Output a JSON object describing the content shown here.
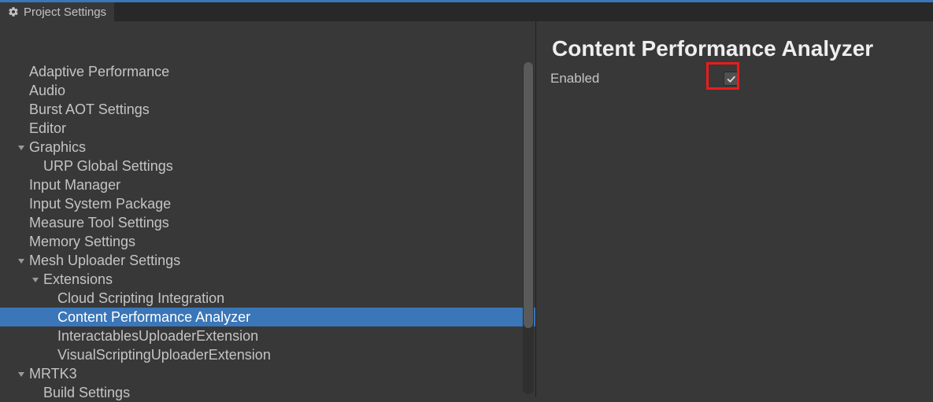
{
  "tab": {
    "title": "Project Settings",
    "icon": "gear-icon"
  },
  "tree": {
    "items": [
      {
        "label": "Adaptive Performance",
        "depth": 0,
        "arrow": "",
        "selected": false,
        "indent": 26
      },
      {
        "label": "Audio",
        "depth": 0,
        "arrow": "",
        "selected": false,
        "indent": 26
      },
      {
        "label": "Burst AOT Settings",
        "depth": 0,
        "arrow": "",
        "selected": false,
        "indent": 26
      },
      {
        "label": "Editor",
        "depth": 0,
        "arrow": "",
        "selected": false,
        "indent": 26
      },
      {
        "label": "Graphics",
        "depth": 0,
        "arrow": "down",
        "selected": false,
        "indent": 11
      },
      {
        "label": "URP Global Settings",
        "depth": 1,
        "arrow": "",
        "selected": false,
        "indent": 44
      },
      {
        "label": "Input Manager",
        "depth": 0,
        "arrow": "",
        "selected": false,
        "indent": 26
      },
      {
        "label": "Input System Package",
        "depth": 0,
        "arrow": "",
        "selected": false,
        "indent": 26
      },
      {
        "label": "Measure Tool Settings",
        "depth": 0,
        "arrow": "",
        "selected": false,
        "indent": 26
      },
      {
        "label": "Memory Settings",
        "depth": 0,
        "arrow": "",
        "selected": false,
        "indent": 26
      },
      {
        "label": "Mesh Uploader Settings",
        "depth": 0,
        "arrow": "down",
        "selected": false,
        "indent": 11
      },
      {
        "label": "Extensions",
        "depth": 1,
        "arrow": "down",
        "selected": false,
        "indent": 29
      },
      {
        "label": "Cloud Scripting Integration",
        "depth": 2,
        "arrow": "",
        "selected": false,
        "indent": 62
      },
      {
        "label": "Content Performance Analyzer",
        "depth": 2,
        "arrow": "",
        "selected": true,
        "indent": 62
      },
      {
        "label": "InteractablesUploaderExtension",
        "depth": 2,
        "arrow": "",
        "selected": false,
        "indent": 62
      },
      {
        "label": "VisualScriptingUploaderExtension",
        "depth": 2,
        "arrow": "",
        "selected": false,
        "indent": 62
      },
      {
        "label": "MRTK3",
        "depth": 0,
        "arrow": "down",
        "selected": false,
        "indent": 11
      },
      {
        "label": "Build Settings",
        "depth": 1,
        "arrow": "",
        "selected": false,
        "indent": 44
      }
    ]
  },
  "panel": {
    "title": "Content Performance Analyzer",
    "enabled_label": "Enabled",
    "enabled_value": true
  },
  "colors": {
    "accent": "#3A76B8",
    "highlight": "#EC1B1B",
    "bg": "#383838"
  }
}
